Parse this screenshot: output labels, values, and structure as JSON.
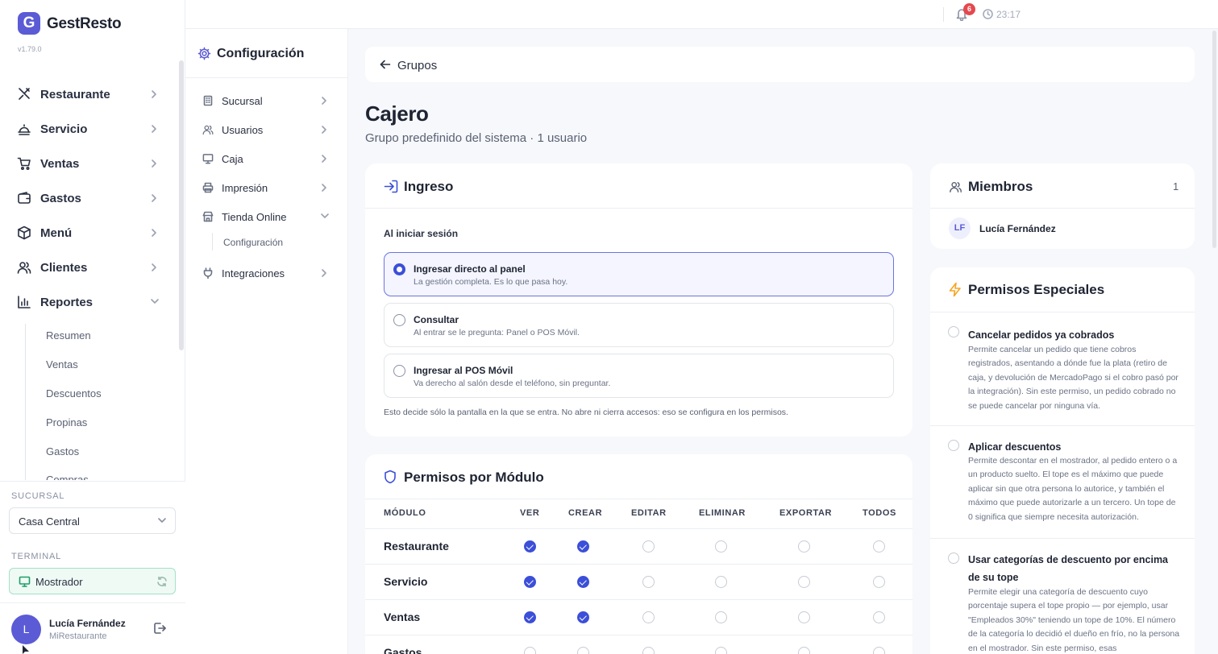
{
  "app": {
    "name": "GestResto",
    "logo_letter": "G",
    "version": "v1.79.0"
  },
  "topbar": {
    "notifications": "6",
    "time": "23:17"
  },
  "nav": {
    "items": [
      {
        "label": "Restaurante",
        "icon": "utensils-icon"
      },
      {
        "label": "Servicio",
        "icon": "cloche-icon"
      },
      {
        "label": "Ventas",
        "icon": "cart-icon"
      },
      {
        "label": "Gastos",
        "icon": "wallet-icon"
      },
      {
        "label": "Menú",
        "icon": "box-icon"
      },
      {
        "label": "Clientes",
        "icon": "users-icon"
      },
      {
        "label": "Reportes",
        "icon": "bar-chart-icon",
        "expanded": true
      }
    ],
    "subitems": [
      "Resumen",
      "Ventas",
      "Descuentos",
      "Propinas",
      "Gastos",
      "Compras"
    ]
  },
  "sidebar_bottom": {
    "sucursal_caption": "SUCURSAL",
    "sucursal_value": "Casa Central",
    "terminal_caption": "TERMINAL",
    "terminal_value": "Mostrador",
    "user_initial": "L",
    "user_name": "Lucía Fernández",
    "user_org": "MiRestaurante"
  },
  "config": {
    "title": "Configuración",
    "items": [
      {
        "label": "Sucursal",
        "icon": "building-icon"
      },
      {
        "label": "Usuarios",
        "icon": "users-icon"
      },
      {
        "label": "Caja",
        "icon": "monitor-icon"
      },
      {
        "label": "Impresión",
        "icon": "printer-icon"
      },
      {
        "label": "Tienda Online",
        "icon": "store-icon",
        "expanded": true
      },
      {
        "label": "Integraciones",
        "icon": "plug-icon"
      }
    ],
    "sub_item": "Configuración"
  },
  "breadcrumb": {
    "label": "Grupos"
  },
  "page": {
    "title": "Cajero",
    "subtitle": "Grupo predefinido del sistema · 1 usuario"
  },
  "ingreso": {
    "title": "Ingreso",
    "label": "Al iniciar sesión",
    "options": [
      {
        "title": "Ingresar directo al panel",
        "desc": "La gestión completa. Es lo que pasa hoy.",
        "selected": true
      },
      {
        "title": "Consultar",
        "desc": "Al entrar se le pregunta: Panel o POS Móvil.",
        "selected": false
      },
      {
        "title": "Ingresar al POS Móvil",
        "desc": "Va derecho al salón desde el teléfono, sin preguntar.",
        "selected": false
      }
    ],
    "note": "Esto decide sólo la pantalla en la que se entra. No abre ni cierra accesos: eso se configura en los permisos."
  },
  "permisos": {
    "title": "Permisos por Módulo",
    "columns": [
      "MÓDULO",
      "VER",
      "CREAR",
      "EDITAR",
      "ELIMINAR",
      "EXPORTAR",
      "TODOS"
    ],
    "rows": [
      {
        "module": "Restaurante",
        "checks": [
          true,
          true,
          false,
          false,
          false,
          false
        ]
      },
      {
        "module": "Servicio",
        "checks": [
          true,
          true,
          false,
          false,
          false,
          false
        ]
      },
      {
        "module": "Ventas",
        "checks": [
          true,
          true,
          false,
          false,
          false,
          false
        ]
      },
      {
        "module": "Gastos",
        "checks": [
          false,
          false,
          false,
          false,
          false,
          false
        ]
      }
    ]
  },
  "miembros": {
    "title": "Miembros",
    "count": "1",
    "members": [
      {
        "initials": "LF",
        "name": "Lucía Fernández"
      }
    ]
  },
  "especiales": {
    "title": "Permisos Especiales",
    "items": [
      {
        "title": "Cancelar pedidos ya cobrados",
        "desc": "Permite cancelar un pedido que tiene cobros registrados, asentando a dónde fue la plata (retiro de caja, y devolución de MercadoPago si el cobro pasó por la integración). Sin este permiso, un pedido cobrado no se puede cancelar por ninguna vía."
      },
      {
        "title": "Aplicar descuentos",
        "desc": "Permite descontar en el mostrador, al pedido entero o a un producto suelto. El tope es el máximo que puede aplicar sin que otra persona lo autorice, y también el máximo que puede autorizarle a un tercero. Un tope de 0 significa que siempre necesita autorización."
      },
      {
        "title": "Usar categorías de descuento por encima de su tope",
        "desc": "Permite elegir una categoría de descuento cuyo porcentaje supera el tope propio — por ejemplo, usar \"Empleados 30%\" teniendo un tope de 10%. El número de la categoría lo decidió el dueño en frío, no la persona en el mostrador. Sin este permiso, esas"
      }
    ]
  },
  "colors": {
    "brand": "#5b5bd6",
    "accent": "#3b4fd8",
    "alert": "#e5484d",
    "success": "#1f9d6b",
    "warning": "#f5a524"
  }
}
